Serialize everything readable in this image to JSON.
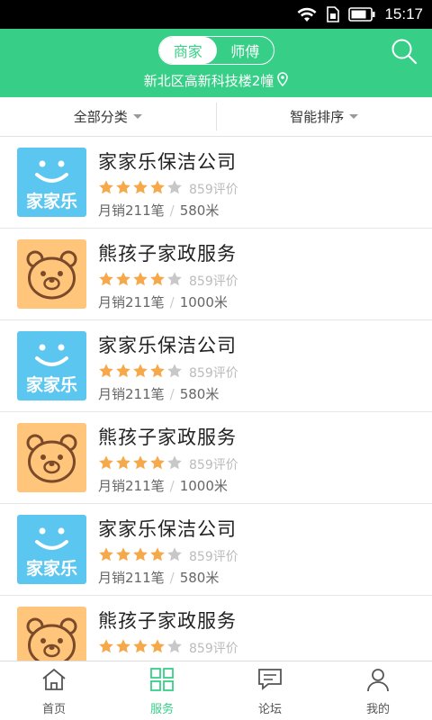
{
  "status_bar": {
    "time": "15:17",
    "icons": [
      "wifi-icon",
      "sim-icon",
      "battery-icon"
    ]
  },
  "header": {
    "segments": [
      {
        "label": "商家",
        "active": true
      },
      {
        "label": "师傅",
        "active": false
      }
    ],
    "location": "新北区高新科技楼2幢",
    "search_icon": "search-icon",
    "accent": "#37cf87"
  },
  "filters": [
    {
      "label": "全部分类"
    },
    {
      "label": "智能排序"
    }
  ],
  "items": [
    {
      "name": "家家乐保洁公司",
      "logo": "blue",
      "rating": 4,
      "reviews": "859评价",
      "sales": "月销211笔",
      "distance": "580米"
    },
    {
      "name": "熊孩子家政服务",
      "logo": "orange",
      "rating": 4,
      "reviews": "859评价",
      "sales": "月销211笔",
      "distance": "1000米"
    },
    {
      "name": "家家乐保洁公司",
      "logo": "blue",
      "rating": 4,
      "reviews": "859评价",
      "sales": "月销211笔",
      "distance": "580米"
    },
    {
      "name": "熊孩子家政服务",
      "logo": "orange",
      "rating": 4,
      "reviews": "859评价",
      "sales": "月销211笔",
      "distance": "1000米"
    },
    {
      "name": "家家乐保洁公司",
      "logo": "blue",
      "rating": 4,
      "reviews": "859评价",
      "sales": "月销211笔",
      "distance": "580米"
    },
    {
      "name": "熊孩子家政服务",
      "logo": "orange",
      "rating": 4,
      "reviews": "859评价",
      "sales": "",
      "distance": ""
    }
  ],
  "logos": {
    "blue_text": "家家乐"
  },
  "tabs": [
    {
      "label": "首页",
      "icon": "home-icon",
      "active": false
    },
    {
      "label": "服务",
      "icon": "grid-icon",
      "active": true
    },
    {
      "label": "论坛",
      "icon": "chat-icon",
      "active": false
    },
    {
      "label": "我的",
      "icon": "user-icon",
      "active": false
    }
  ],
  "colors": {
    "star_on": "#f5a94a",
    "star_off": "#c8c8c8",
    "blue_logo": "#5bc6f0",
    "orange_logo": "#ffc57a"
  }
}
